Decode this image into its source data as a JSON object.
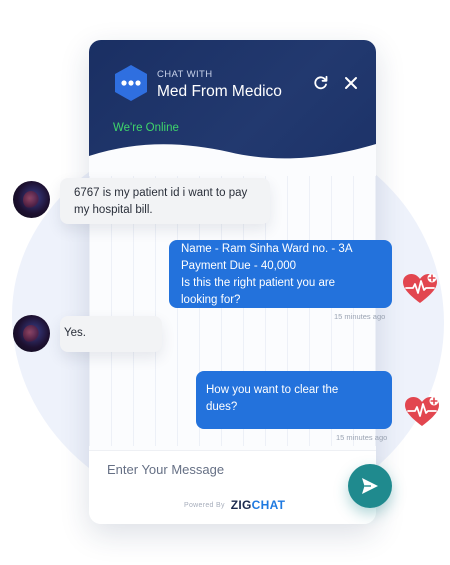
{
  "header": {
    "chat_with": "CHAT WITH",
    "bot_name": "Med From Medico",
    "status": "We're Online"
  },
  "messages": [
    {
      "sender": "user",
      "text_lines": [
        "6767 is my patient id i want to pay",
        "my hospital bill."
      ]
    },
    {
      "sender": "bot",
      "text_lines": [
        "Name - Ram Sinha Ward no. - 3A",
        "Payment Due - 40,000",
        "Is this the right patient you are",
        "looking for?"
      ],
      "time": "15 minutes ago"
    },
    {
      "sender": "user",
      "text_lines": [
        "Yes."
      ]
    },
    {
      "sender": "bot",
      "text_lines": [
        "How you want to clear the",
        "dues?"
      ],
      "time": "15 minutes ago"
    }
  ],
  "composer": {
    "placeholder": "Enter Your Message"
  },
  "footer": {
    "powered_by": "Powered By",
    "brand_part1": "ZIG",
    "brand_part2": "CHAT"
  },
  "colors": {
    "header_bg": "#1a2f63",
    "accent_blue": "#2372dc",
    "online_green": "#3fd56b",
    "send_teal": "#1f8a8e",
    "heart_red": "#e2464f"
  }
}
